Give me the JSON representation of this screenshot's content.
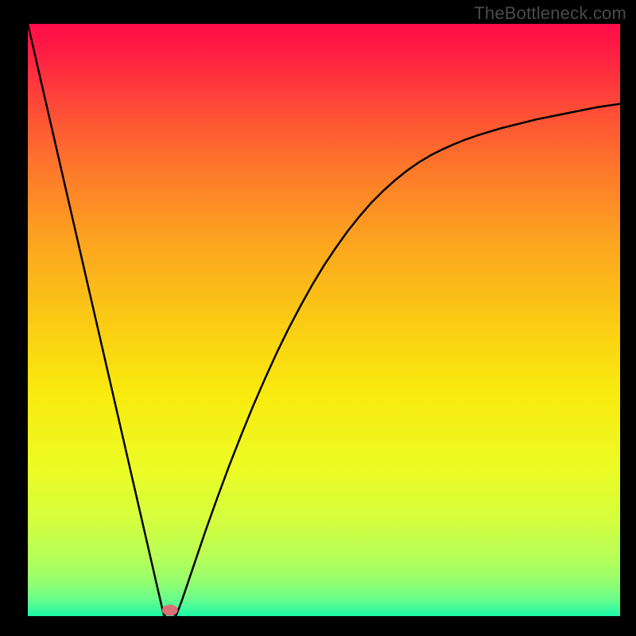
{
  "watermark": "TheBottleneck.com",
  "chart_data": {
    "type": "line",
    "title": "",
    "xlabel": "",
    "ylabel": "",
    "xlim": [
      0,
      100
    ],
    "ylim": [
      0,
      100
    ],
    "x": [
      0,
      2,
      4,
      6,
      8,
      10,
      12,
      14,
      16,
      18,
      20,
      22,
      23,
      24,
      25,
      26,
      28,
      30,
      32,
      34,
      36,
      38,
      40,
      42,
      44,
      46,
      48,
      50,
      52,
      54,
      56,
      58,
      60,
      62,
      64,
      66,
      68,
      70,
      72,
      74,
      76,
      78,
      80,
      82,
      84,
      86,
      88,
      90,
      92,
      94,
      96,
      98,
      100
    ],
    "values": [
      100.0,
      91.3,
      82.6,
      73.9,
      65.2,
      56.5,
      47.8,
      39.1,
      30.4,
      21.7,
      13.0,
      4.3,
      0.0,
      1.0,
      0.0,
      2.6,
      8.5,
      14.4,
      20.0,
      25.4,
      30.5,
      35.4,
      40.0,
      44.4,
      48.5,
      52.3,
      55.9,
      59.2,
      62.2,
      65.0,
      67.5,
      69.8,
      71.8,
      73.6,
      75.2,
      76.6,
      77.8,
      78.8,
      79.7,
      80.5,
      81.2,
      81.8,
      82.4,
      82.9,
      83.4,
      83.9,
      84.3,
      84.7,
      85.1,
      85.5,
      85.9,
      86.2,
      86.5
    ],
    "marker": {
      "x": 24,
      "y": 1
    },
    "gradient_stops": [
      {
        "offset": 0.0,
        "color": "#ff0b48"
      },
      {
        "offset": 0.05,
        "color": "#ff1f42"
      },
      {
        "offset": 0.15,
        "color": "#fe4f36"
      },
      {
        "offset": 0.25,
        "color": "#fd7a2a"
      },
      {
        "offset": 0.37,
        "color": "#fca51f"
      },
      {
        "offset": 0.5,
        "color": "#fbca14"
      },
      {
        "offset": 0.62,
        "color": "#f9ea0e"
      },
      {
        "offset": 0.75,
        "color": "#ecfb24"
      },
      {
        "offset": 0.84,
        "color": "#d3fe3e"
      },
      {
        "offset": 0.9,
        "color": "#b7fe57"
      },
      {
        "offset": 0.94,
        "color": "#97fe6f"
      },
      {
        "offset": 0.97,
        "color": "#6cfd8a"
      },
      {
        "offset": 1.0,
        "color": "#1bf8a8"
      }
    ]
  }
}
